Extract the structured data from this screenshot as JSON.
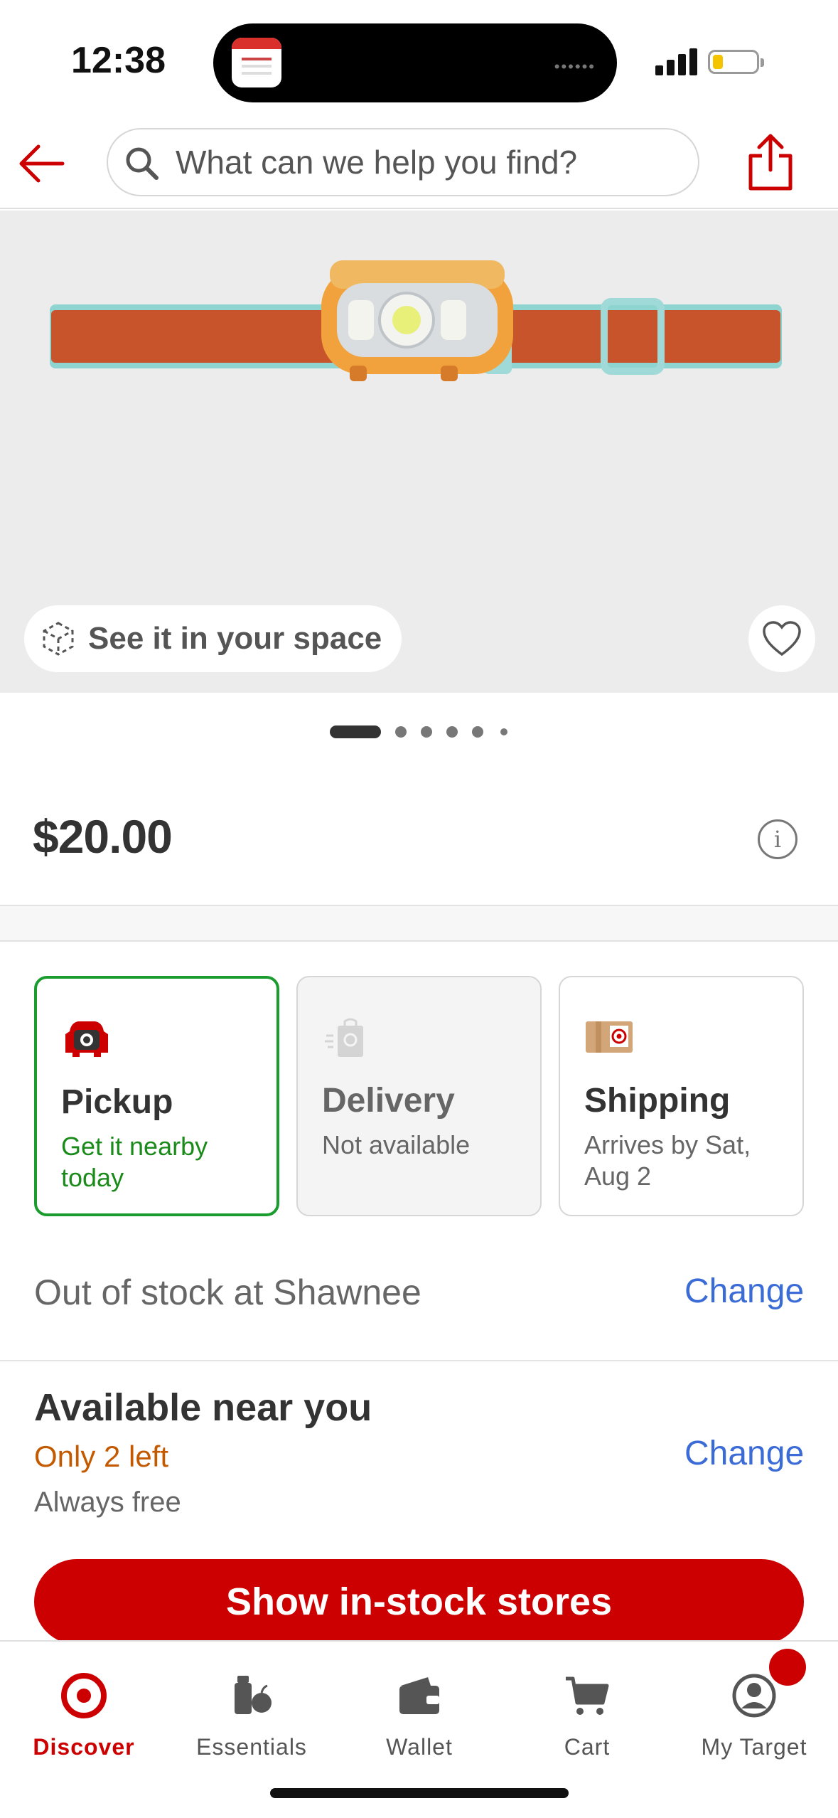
{
  "status": {
    "time": "12:38",
    "island_app_icon": "attached-app-icon",
    "signal_icon": "cellular-signal-icon",
    "battery_icon": "battery-low-icon"
  },
  "header": {
    "search_placeholder": "What can we help you find?",
    "back_icon": "back-arrow-icon",
    "share_icon": "share-icon"
  },
  "hero": {
    "see_space_label": "See it in your space",
    "ar_icon": "ar-cube-icon",
    "favorite_icon": "heart-icon",
    "image_count": 6,
    "active_index": 0
  },
  "product": {
    "price": "$20.00"
  },
  "fulfillment": [
    {
      "title": "Pickup",
      "sub": "Get it nearby today",
      "state": "selected",
      "icon": "pickup-car-icon"
    },
    {
      "title": "Delivery",
      "sub": "Not available",
      "state": "disabled",
      "icon": "delivery-bag-icon"
    },
    {
      "title": "Shipping",
      "sub": "Arrives by Sat, Aug 2",
      "state": "default",
      "icon": "shipping-box-icon"
    }
  ],
  "store": {
    "status_text": "Out of stock at Shawnee",
    "change_label": "Change"
  },
  "nearby": {
    "title": "Available near you",
    "stock_text": "Only 2 left",
    "shipping_note": "Always free",
    "change_label": "Change"
  },
  "cta_label": "Show in-stock stores",
  "tabs": [
    {
      "label": "Discover",
      "icon": "target-bullseye-icon",
      "active": true
    },
    {
      "label": "Essentials",
      "icon": "essentials-icon",
      "active": false
    },
    {
      "label": "Wallet",
      "icon": "wallet-icon",
      "active": false
    },
    {
      "label": "Cart",
      "icon": "cart-icon",
      "active": false
    },
    {
      "label": "My Target",
      "icon": "account-icon",
      "active": false
    }
  ],
  "colors": {
    "brand_red": "#cc0000",
    "pickup_green": "#1a9c2e",
    "link_blue": "#3a6bd6",
    "stock_orange": "#c35a00"
  }
}
